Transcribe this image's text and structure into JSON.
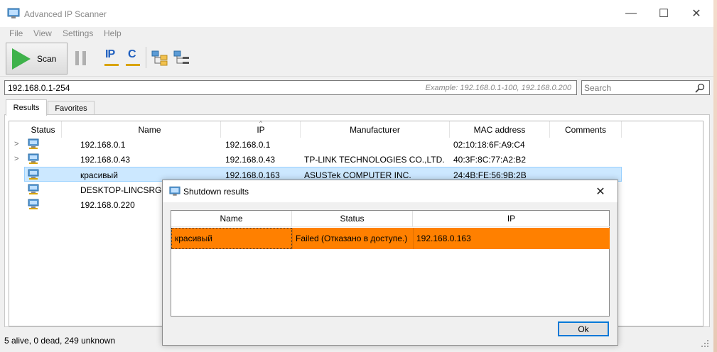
{
  "window": {
    "title": "Advanced IP Scanner",
    "minimize_glyph": "—",
    "maximize_glyph": "☐",
    "close_glyph": "✕"
  },
  "menu": {
    "items": [
      "File",
      "View",
      "Settings",
      "Help"
    ]
  },
  "toolbar": {
    "scan_label": "Scan",
    "ip_label": "IP",
    "c_label": "C"
  },
  "address": {
    "value": "192.168.0.1-254",
    "example": "Example: 192.168.0.1-100, 192.168.0.200"
  },
  "search": {
    "placeholder": "Search"
  },
  "tabs": [
    "Results",
    "Favorites"
  ],
  "results": {
    "columns": [
      "Status",
      "Name",
      "IP",
      "Manufacturer",
      "MAC address",
      "Comments"
    ],
    "sorted_column": "IP",
    "rows": [
      {
        "expandable": true,
        "name": "192.168.0.1",
        "ip": "192.168.0.1",
        "manufacturer": "",
        "mac": "02:10:18:6F:A9:C4",
        "comments": ""
      },
      {
        "expandable": true,
        "name": "192.168.0.43",
        "ip": "192.168.0.43",
        "manufacturer": "TP-LINK TECHNOLOGIES CO.,LTD.",
        "mac": "40:3F:8C:77:A2:B2",
        "comments": ""
      },
      {
        "expandable": false,
        "name": "красивый",
        "ip": "192.168.0.163",
        "manufacturer": "ASUSTek COMPUTER INC.",
        "mac": "24:4B:FE:56:9B:2B",
        "comments": "",
        "selected": true
      },
      {
        "expandable": false,
        "name": "DESKTOP-LINCSRG",
        "ip": "",
        "manufacturer": "",
        "mac": "",
        "comments": ""
      },
      {
        "expandable": false,
        "name": "192.168.0.220",
        "ip": "",
        "manufacturer": "",
        "mac": "",
        "comments": ""
      }
    ]
  },
  "status": {
    "text": "5 alive, 0 dead, 249 unknown"
  },
  "dialog": {
    "title": "Shutdown results",
    "columns": [
      "Name",
      "Status",
      "IP"
    ],
    "rows": [
      {
        "name": "красивый",
        "status": "Failed (Отказано в доступе.)",
        "ip": "192.168.0.163"
      }
    ],
    "ok_label": "Ok",
    "close_glyph": "✕"
  },
  "colors": {
    "scan_green": "#3fb24b",
    "toolbar_blue": "#1f5fbf",
    "selection_bg": "#cce8ff",
    "failure_orange": "#ff8000"
  }
}
